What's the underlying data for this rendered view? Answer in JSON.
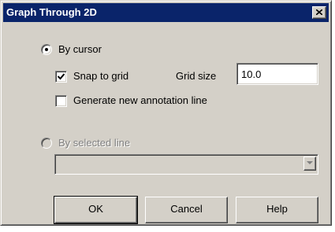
{
  "window": {
    "title": "Graph Through 2D",
    "close_icon": "close-icon"
  },
  "options": {
    "by_cursor": {
      "label": "By cursor",
      "selected": true
    },
    "snap_to_grid": {
      "label": "Snap to grid",
      "checked": true
    },
    "grid_size": {
      "label": "Grid size",
      "value": "10.0"
    },
    "generate_annotation": {
      "label": "Generate new annotation line",
      "checked": false
    },
    "by_selected_line": {
      "label": "By selected line",
      "selected": false,
      "disabled": true
    },
    "line_select": {
      "value": "",
      "disabled": true
    }
  },
  "buttons": {
    "ok": "OK",
    "cancel": "Cancel",
    "help": "Help"
  },
  "colors": {
    "title_bar": "#0a246a",
    "face": "#d4d0c8"
  }
}
